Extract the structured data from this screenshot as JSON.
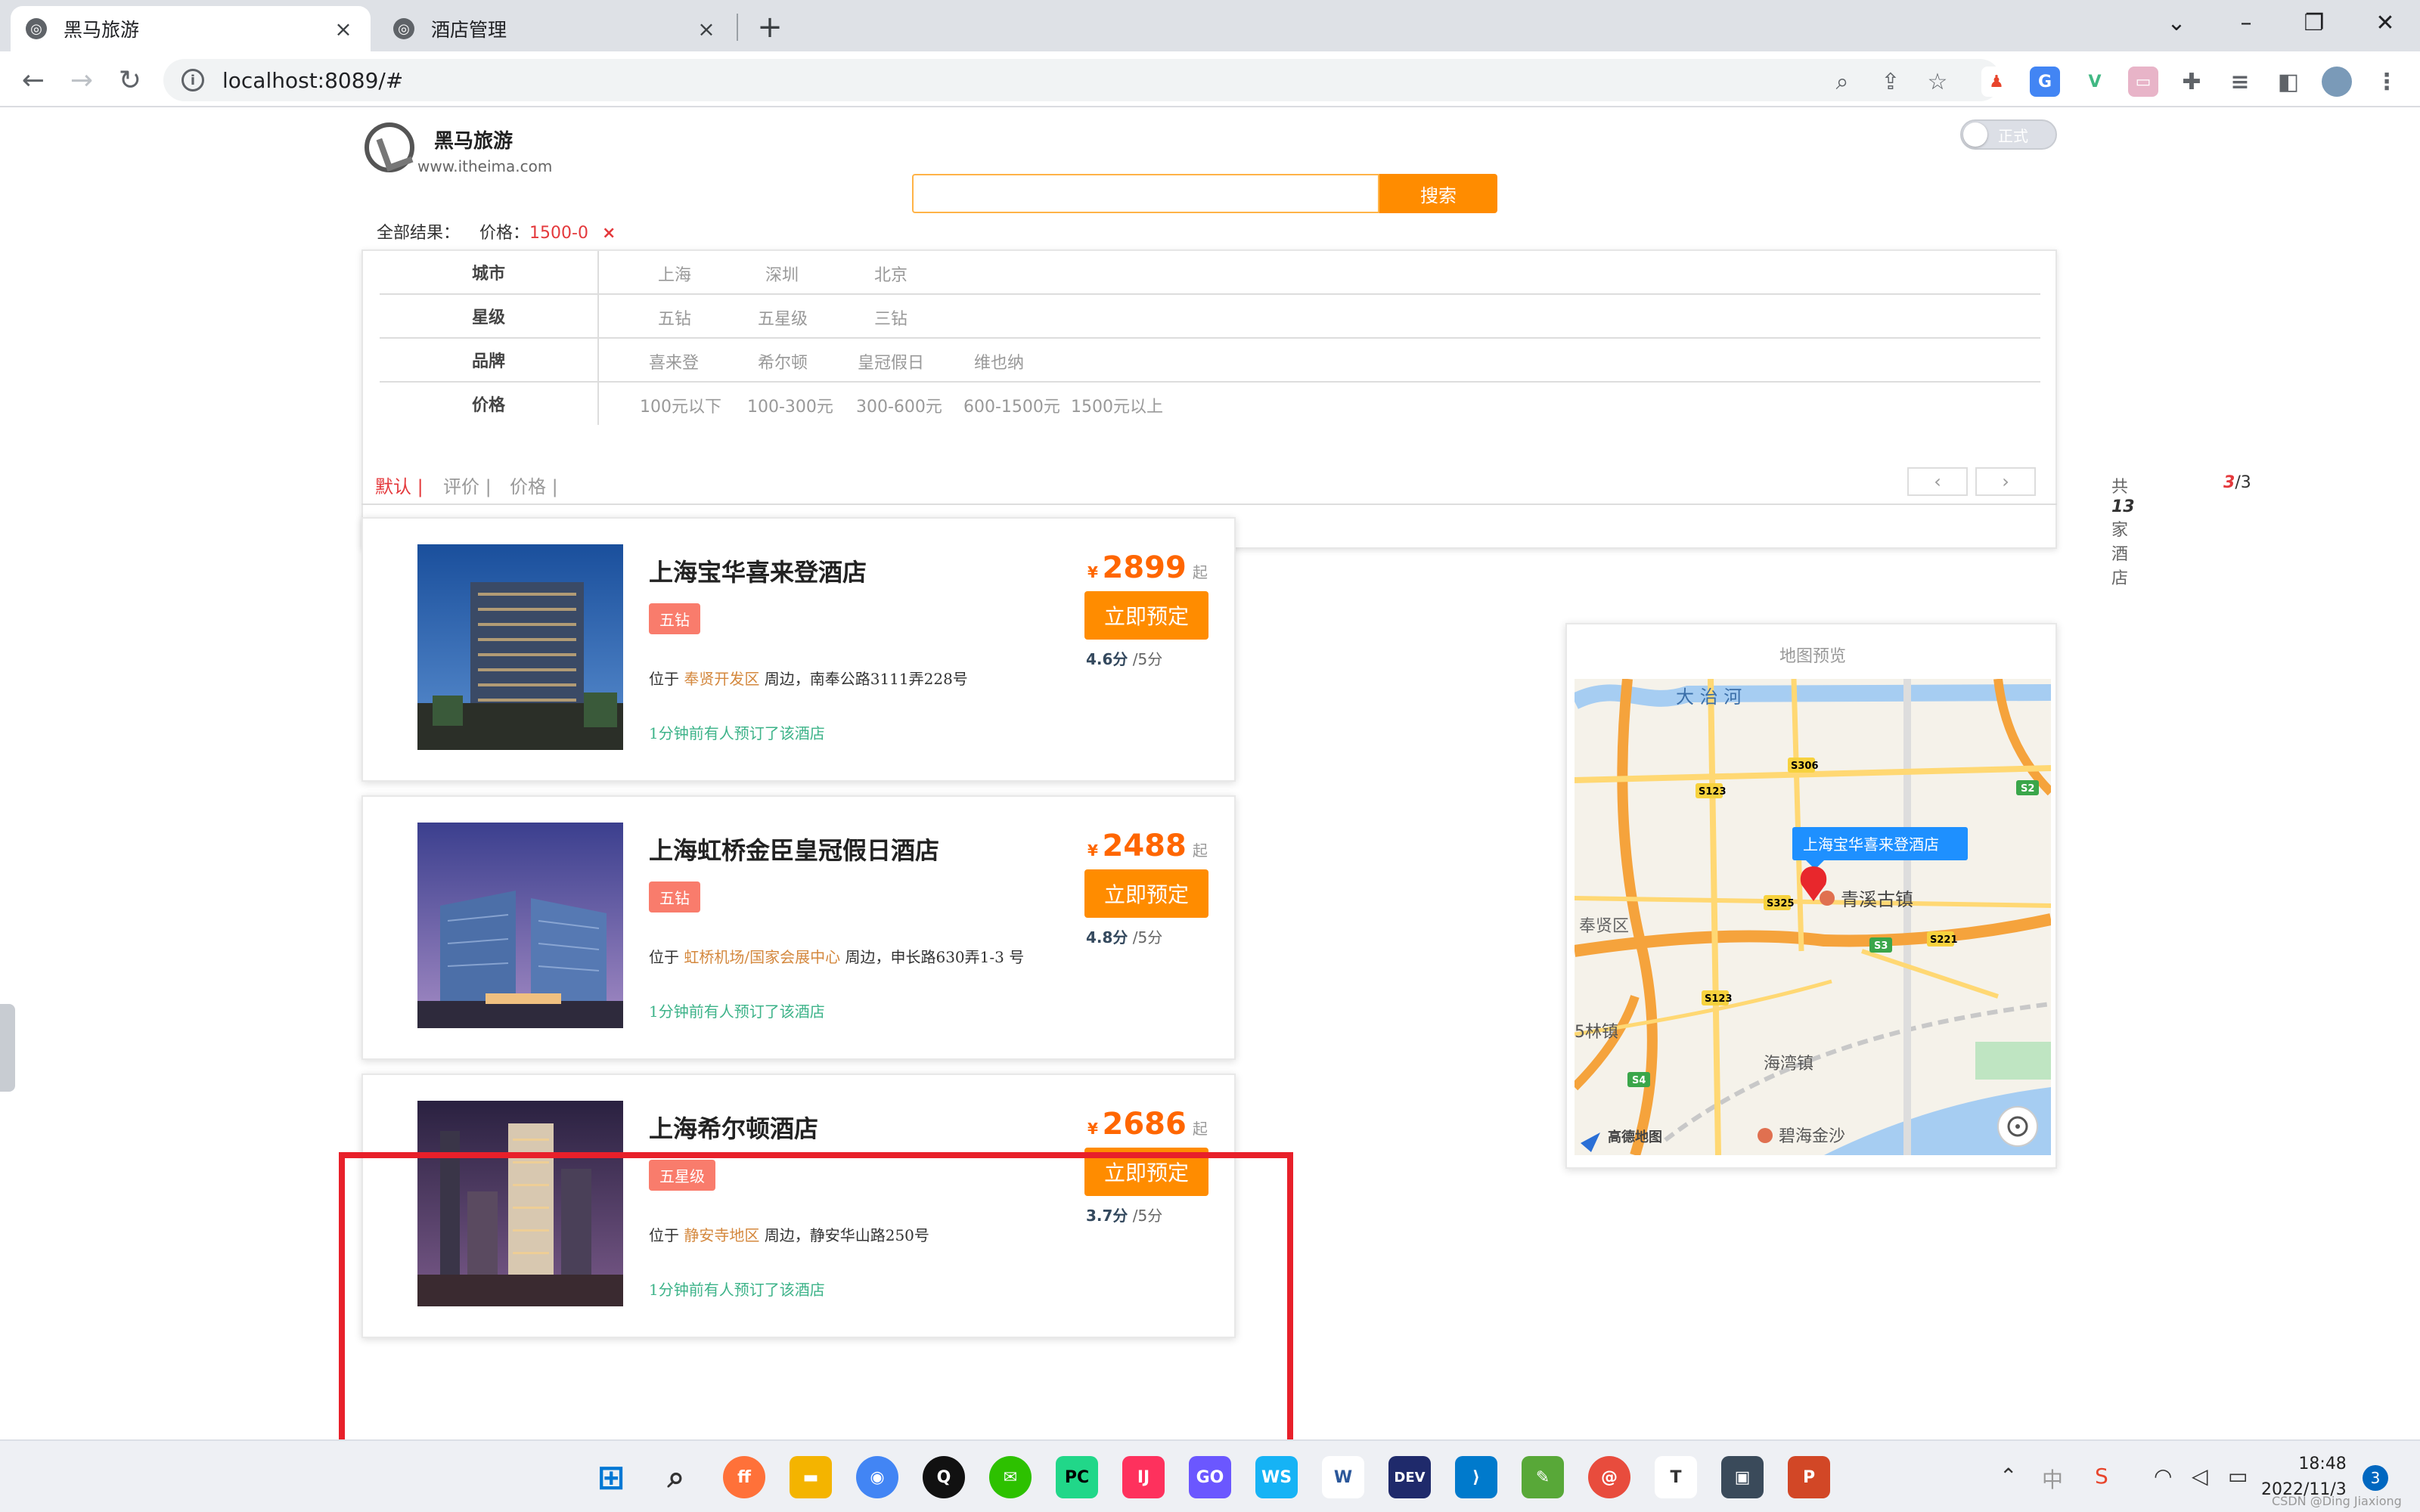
{
  "browser": {
    "tabs": [
      {
        "title": "黑马旅游",
        "active": true
      },
      {
        "title": "酒店管理",
        "active": false
      }
    ],
    "url": "localhost:8089/#"
  },
  "site": {
    "name": "黑马旅游",
    "url": "www.itheima.com",
    "toggle_label": "正式",
    "search_button": "搜索",
    "search_value": ""
  },
  "filters": {
    "all_results_label": "全部结果：",
    "active_chip_label": "价格：",
    "active_chip_value": "1500-0",
    "active_chip_remove": "×",
    "rows": [
      {
        "label": "城市",
        "options": [
          "上海",
          "深圳",
          "北京"
        ]
      },
      {
        "label": "星级",
        "options": [
          "五钻",
          "五星级",
          "三钻"
        ]
      },
      {
        "label": "品牌",
        "options": [
          "喜来登",
          "希尔顿",
          "皇冠假日",
          "维也纳"
        ]
      },
      {
        "label": "价格",
        "options": [
          "100元以下",
          "100-300元",
          "300-600元",
          "600-1500元",
          "1500元以上"
        ]
      }
    ]
  },
  "sort": {
    "options": [
      "默认 |",
      "评价 |",
      "价格 |"
    ],
    "active": "默认 |",
    "total_prefix": "共",
    "total_count": "13",
    "total_suffix": "家酒店",
    "page_current": "3",
    "page_total": "/3",
    "prev": "‹",
    "next": "›"
  },
  "hotels": [
    {
      "name": "上海宝华喜来登酒店",
      "star": "五钻",
      "addr_prefix": "位于",
      "business": "奉贤开发区",
      "addr_suffix": "周边，南奉公路3111弄228号",
      "booked": "1分钟前有人预订了该酒店",
      "currency": "¥",
      "price": "2899",
      "price_suffix": "起",
      "book": "立即预定",
      "score": "4.6分",
      "score_suffix": "/5分"
    },
    {
      "name": "上海虹桥金臣皇冠假日酒店",
      "star": "五钻",
      "addr_prefix": "位于",
      "business": "虹桥机场/国家会展中心",
      "addr_suffix": "周边，申长路630弄1-3 号",
      "booked": "1分钟前有人预订了该酒店",
      "currency": "¥",
      "price": "2488",
      "price_suffix": "起",
      "book": "立即预定",
      "score": "4.8分",
      "score_suffix": "/5分"
    },
    {
      "name": "上海希尔顿酒店",
      "star": "五星级",
      "addr_prefix": "位于",
      "business": "静安寺地区",
      "addr_suffix": "周边，静安华山路250号",
      "booked": "1分钟前有人预订了该酒店",
      "currency": "¥",
      "price": "2686",
      "price_suffix": "起",
      "book": "立即预定",
      "score": "3.7分",
      "score_suffix": "/5分"
    }
  ],
  "map": {
    "title": "地图预览",
    "popup": "上海宝华喜来登酒店",
    "labels": {
      "river": "大 治 河",
      "town1": "青溪古镇",
      "district": "奉贤区",
      "town2": "海湾镇",
      "town3": "5林镇",
      "poi": "碧海金沙",
      "brand": "高德地图"
    },
    "roads": [
      "S306",
      "S123",
      "S2",
      "S325",
      "S3",
      "S221",
      "S123",
      "S4"
    ]
  },
  "taskbar": {
    "time": "18:48",
    "date": "2022/11/3",
    "notifications": "3",
    "watermark": "CSDN @Ding Jiaxiong"
  },
  "colors": {
    "accent": "#ff8c00",
    "red": "#e4393c",
    "badge": "#f97c6c",
    "green_text": "#3db389",
    "highlight": "#e8202a"
  }
}
